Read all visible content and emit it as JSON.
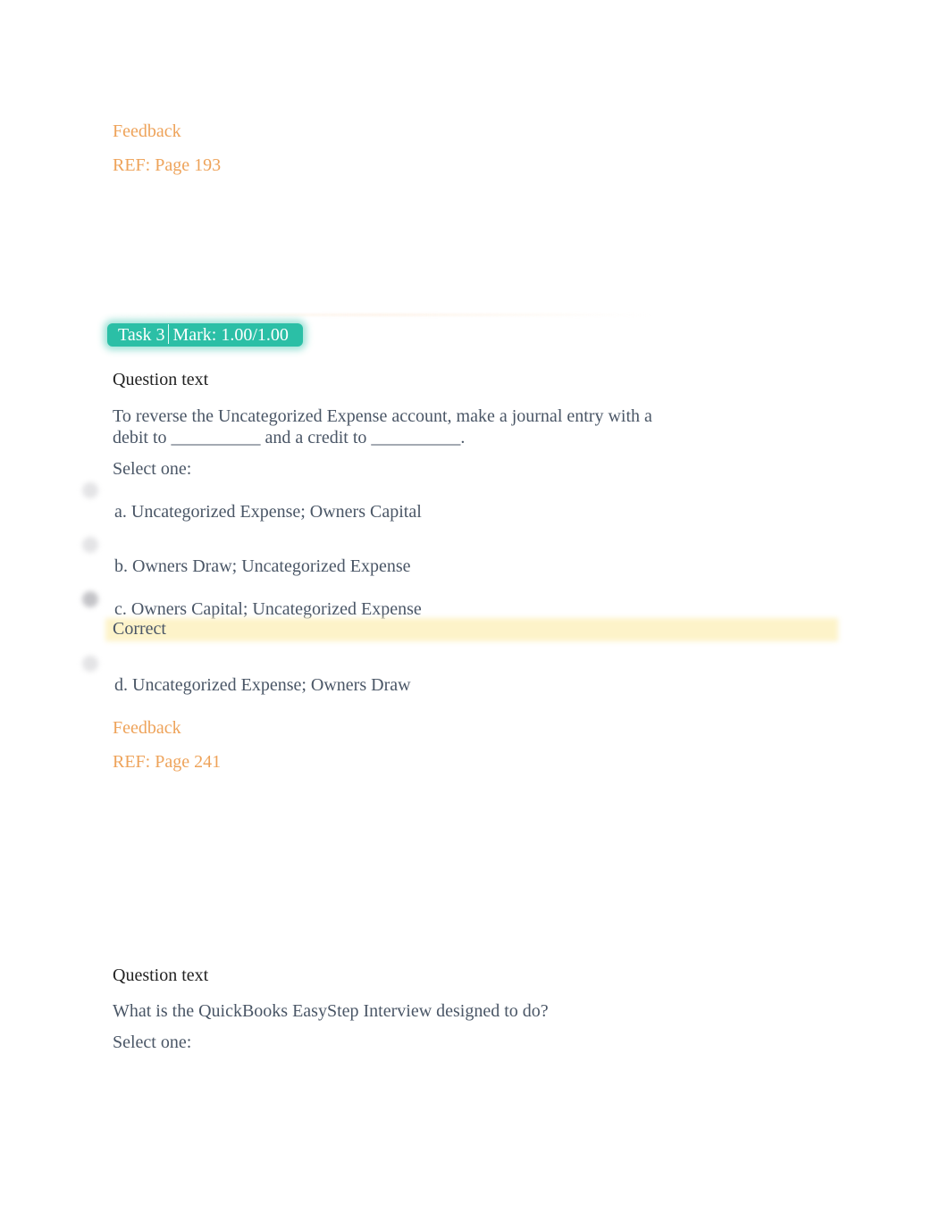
{
  "prev_feedback": {
    "label": "Feedback",
    "ref": "REF: Page 193"
  },
  "task": {
    "task_label": "Task 3",
    "mark_label": "Mark: 1.00/1.00",
    "badge_color": "#2bbfa6"
  },
  "question": {
    "heading": "Question text",
    "text_line1": "To reverse the Uncategorized Expense account, make a journal entry with a",
    "text_line2": "debit to __________ and a credit to __________.",
    "prompt": "Select one:",
    "options": [
      {
        "label": "a. Uncategorized Expense; Owners Capital",
        "selected": false
      },
      {
        "label": "b. Owners Draw; Uncategorized Expense",
        "selected": false
      },
      {
        "label": "c. Owners Capital; Uncategorized Expense",
        "selected": true
      },
      {
        "label": "d. Uncategorized Expense; Owners Draw",
        "selected": false
      }
    ],
    "correct_label": "Correct",
    "feedback_label": "Feedback",
    "feedback_ref": "REF: Page 241"
  },
  "next_question": {
    "heading": "Question text",
    "text": "What is the QuickBooks EasyStep Interview designed to do?",
    "prompt": "Select one:"
  }
}
